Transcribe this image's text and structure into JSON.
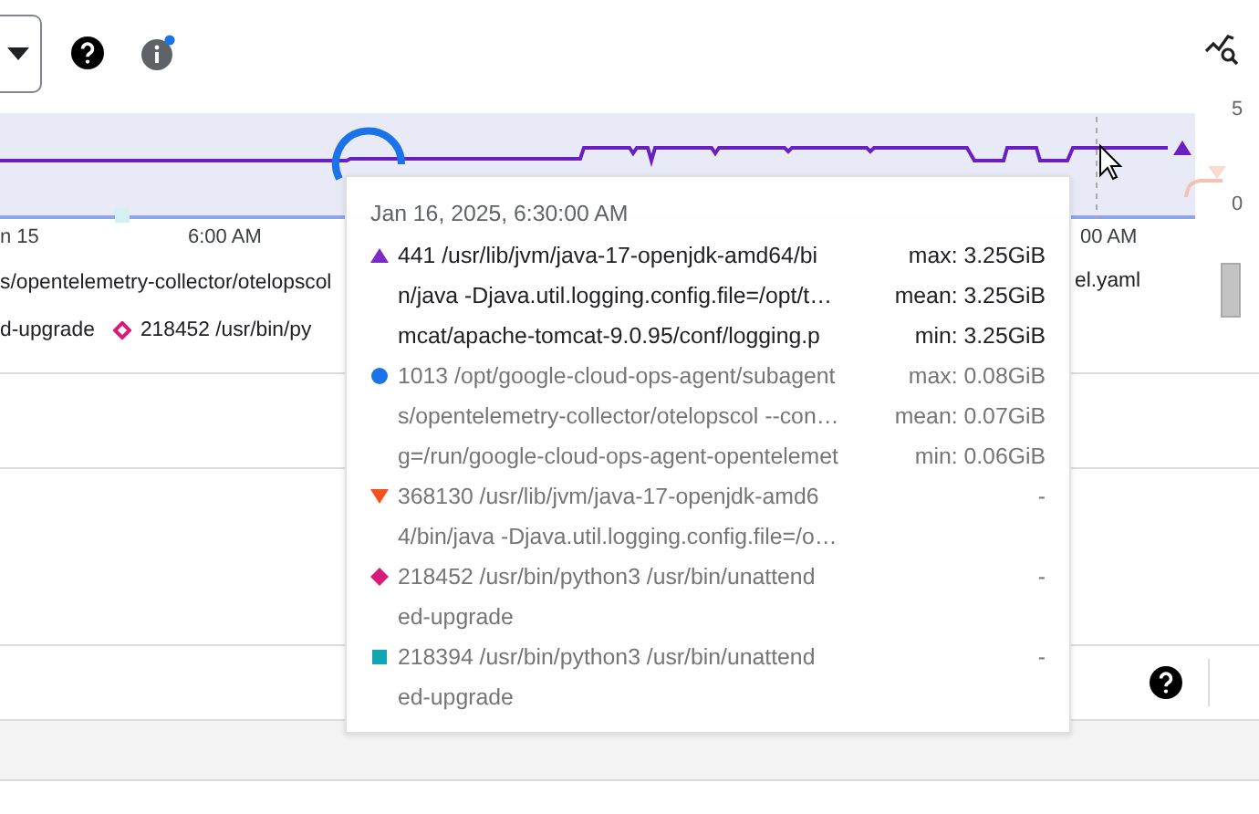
{
  "chart": {
    "y_labels": [
      "5",
      "0"
    ],
    "x_labels": [
      "n 15",
      "6:00 AM",
      "00 AM"
    ]
  },
  "legend_rows": [
    {
      "items": [
        {
          "kind": "plain",
          "text": "s/opentelemetry-collector/otelopscol"
        },
        {
          "kind": "plain",
          "text": "el.yaml"
        }
      ]
    },
    {
      "items": [
        {
          "kind": "plain",
          "text": "d-upgrade"
        },
        {
          "kind": "diamond",
          "color": "#d81b7a",
          "text": "218452 /usr/bin/py"
        }
      ]
    }
  ],
  "tooltip": {
    "title": "Jan 16, 2025, 6:30:00 AM",
    "items": [
      {
        "kind": "triangle-up",
        "color": "#7b2bc4",
        "selected": true,
        "lines": [
          "441 /usr/lib/jvm/java-17-openjdk-amd64/bi",
          "n/java -Djava.util.logging.config.file=/opt/t…",
          "mcat/apache-tomcat-9.0.95/conf/logging.p"
        ],
        "stats": [
          "max: 3.25GiB",
          "mean: 3.25GiB",
          "min: 3.25GiB"
        ]
      },
      {
        "kind": "circle",
        "color": "#1a73e8",
        "selected": false,
        "lines": [
          "1013 /opt/google-cloud-ops-agent/subagent",
          "s/opentelemetry-collector/otelopscol --con…",
          "g=/run/google-cloud-ops-agent-opentelemet"
        ],
        "stats": [
          "max: 0.08GiB",
          "mean: 0.07GiB",
          "min: 0.06GiB"
        ]
      },
      {
        "kind": "triangle-down",
        "color": "#f4511e",
        "selected": false,
        "lines": [
          "368130 /usr/lib/jvm/java-17-openjdk-amd6",
          "4/bin/java -Djava.util.logging.config.file=/o…"
        ],
        "stats": [
          "-"
        ]
      },
      {
        "kind": "diamond",
        "color": "#d81b7a",
        "selected": false,
        "lines": [
          "218452 /usr/bin/python3 /usr/bin/unattend",
          "ed-upgrade"
        ],
        "stats": [
          "-"
        ]
      },
      {
        "kind": "square",
        "color": "#12a4b4",
        "selected": false,
        "lines": [
          "218394 /usr/bin/python3 /usr/bin/unattend",
          "ed-upgrade"
        ],
        "stats": [
          "-"
        ]
      }
    ]
  }
}
